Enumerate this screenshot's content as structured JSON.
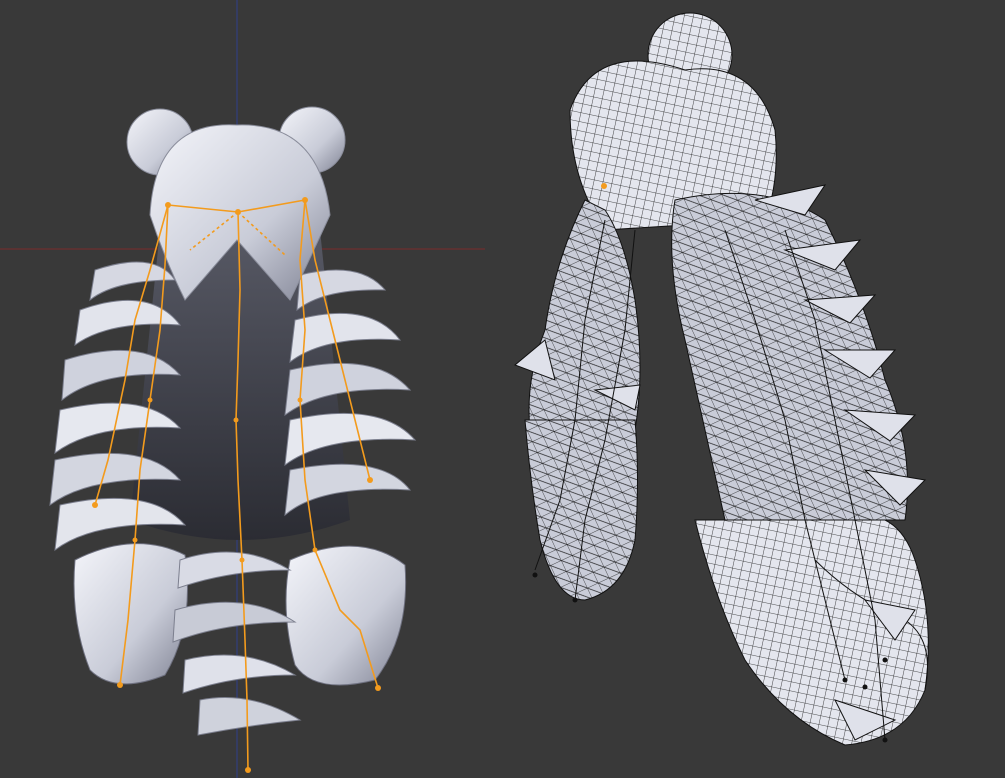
{
  "viewports": [
    {
      "id": "left",
      "view": "front",
      "mode": "solid-with-armature"
    },
    {
      "id": "right",
      "view": "side",
      "mode": "solid-with-wireframe"
    }
  ],
  "colors": {
    "background": "#393939",
    "axis_x": "#7a2a2a",
    "axis_z": "#2e3f8c",
    "mesh_light": "#e6e8f0",
    "mesh_shadow": "#6f7180",
    "armature": "#f39b1d",
    "wire": "#141414"
  }
}
